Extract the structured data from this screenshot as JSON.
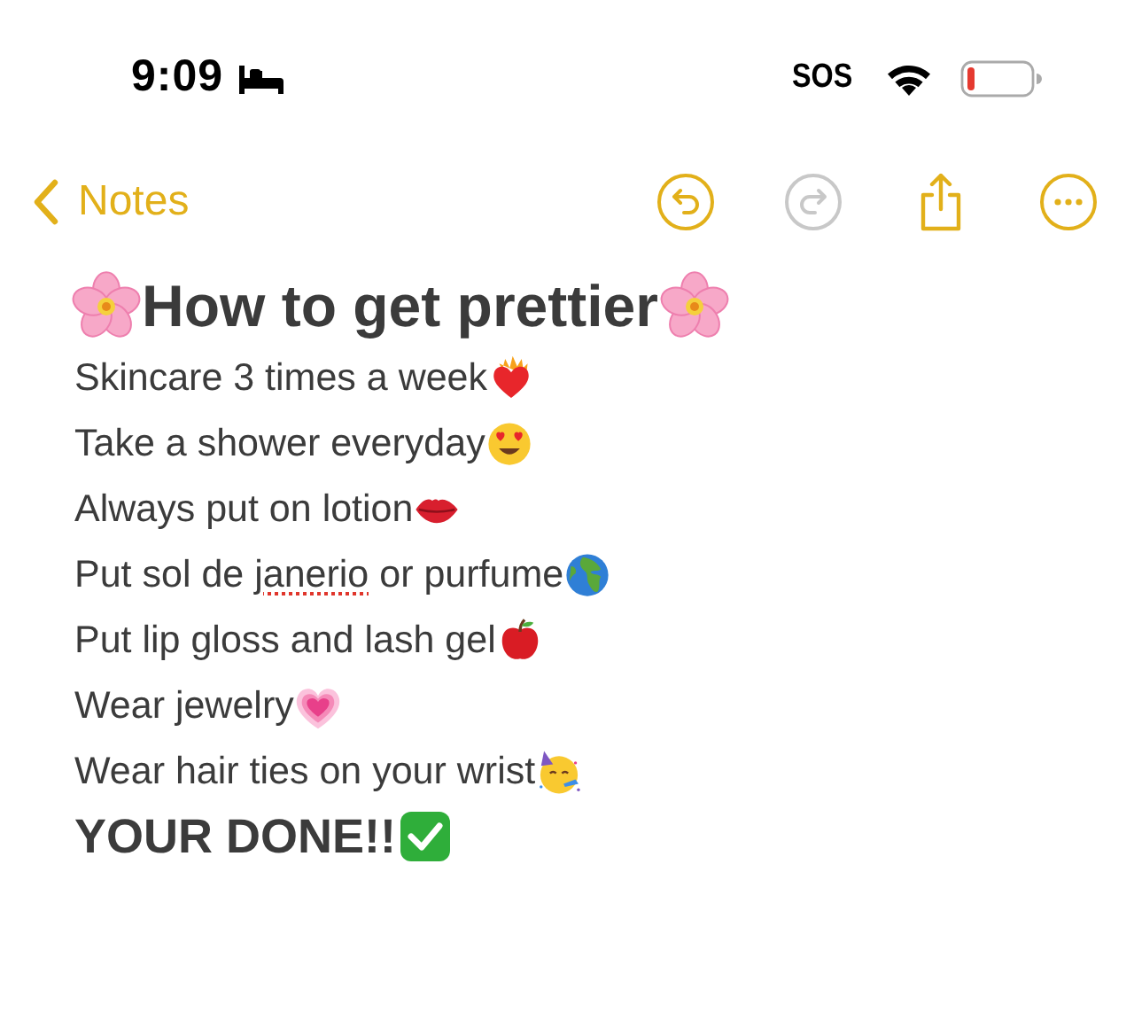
{
  "status_bar": {
    "time": "9:09",
    "carrier": "SOS"
  },
  "toolbar": {
    "back_label": "Notes",
    "buttons": [
      {
        "kind": "undo",
        "disabled": false
      },
      {
        "kind": "redo",
        "disabled": true
      },
      {
        "kind": "share",
        "disabled": false
      },
      {
        "kind": "more",
        "disabled": false
      }
    ]
  },
  "note": {
    "title": {
      "text": "How to get prettier",
      "kind": "flower"
    },
    "lines": [
      {
        "segments": [
          {
            "text": "Skincare 3 times a week",
            "misspelled": false
          }
        ],
        "kind": "fire-heart",
        "bold": false
      },
      {
        "segments": [
          {
            "text": "Take a shower everyday",
            "misspelled": false
          }
        ],
        "kind": "heart-eyes",
        "bold": false
      },
      {
        "segments": [
          {
            "text": "Always put on lotion",
            "misspelled": false
          }
        ],
        "kind": "lips",
        "bold": false
      },
      {
        "segments": [
          {
            "text": "Put sol de ",
            "misspelled": false
          },
          {
            "text": "janerio",
            "misspelled": true
          },
          {
            "text": " or purfume",
            "misspelled": false
          }
        ],
        "kind": "globe",
        "bold": false
      },
      {
        "segments": [
          {
            "text": "Put lip gloss and lash gel",
            "misspelled": false
          }
        ],
        "kind": "apple",
        "bold": false
      },
      {
        "segments": [
          {
            "text": "Wear jewelry",
            "misspelled": false
          }
        ],
        "kind": "growing-heart",
        "bold": false
      },
      {
        "segments": [
          {
            "text": "Wear hair ties on your wrist",
            "misspelled": false
          }
        ],
        "kind": "party-face",
        "bold": false
      },
      {
        "segments": [
          {
            "text": "YOUR DONE!!",
            "misspelled": false
          }
        ],
        "kind": "check",
        "bold": true
      }
    ]
  }
}
